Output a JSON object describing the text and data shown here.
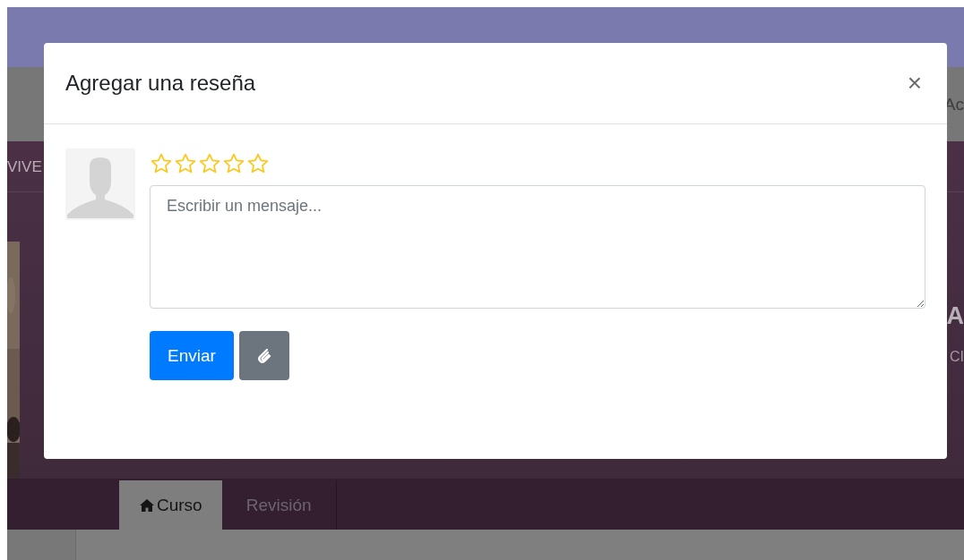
{
  "background": {
    "nav_fragment": "VIVE",
    "header_fragment": "Ac",
    "title_fragment": "A",
    "subtitle_fragment": "CI",
    "tabs": [
      {
        "label": "Curso",
        "selected": true
      },
      {
        "label": "Revisión",
        "selected": false
      }
    ]
  },
  "modal": {
    "title": "Agregar una reseña",
    "close": "×",
    "stars": 0,
    "message": {
      "placeholder": "Escribir un mensaje..."
    },
    "buttons": [
      {
        "kind": "primary",
        "label": "Enviar"
      },
      {
        "kind": "attach"
      }
    ]
  }
}
